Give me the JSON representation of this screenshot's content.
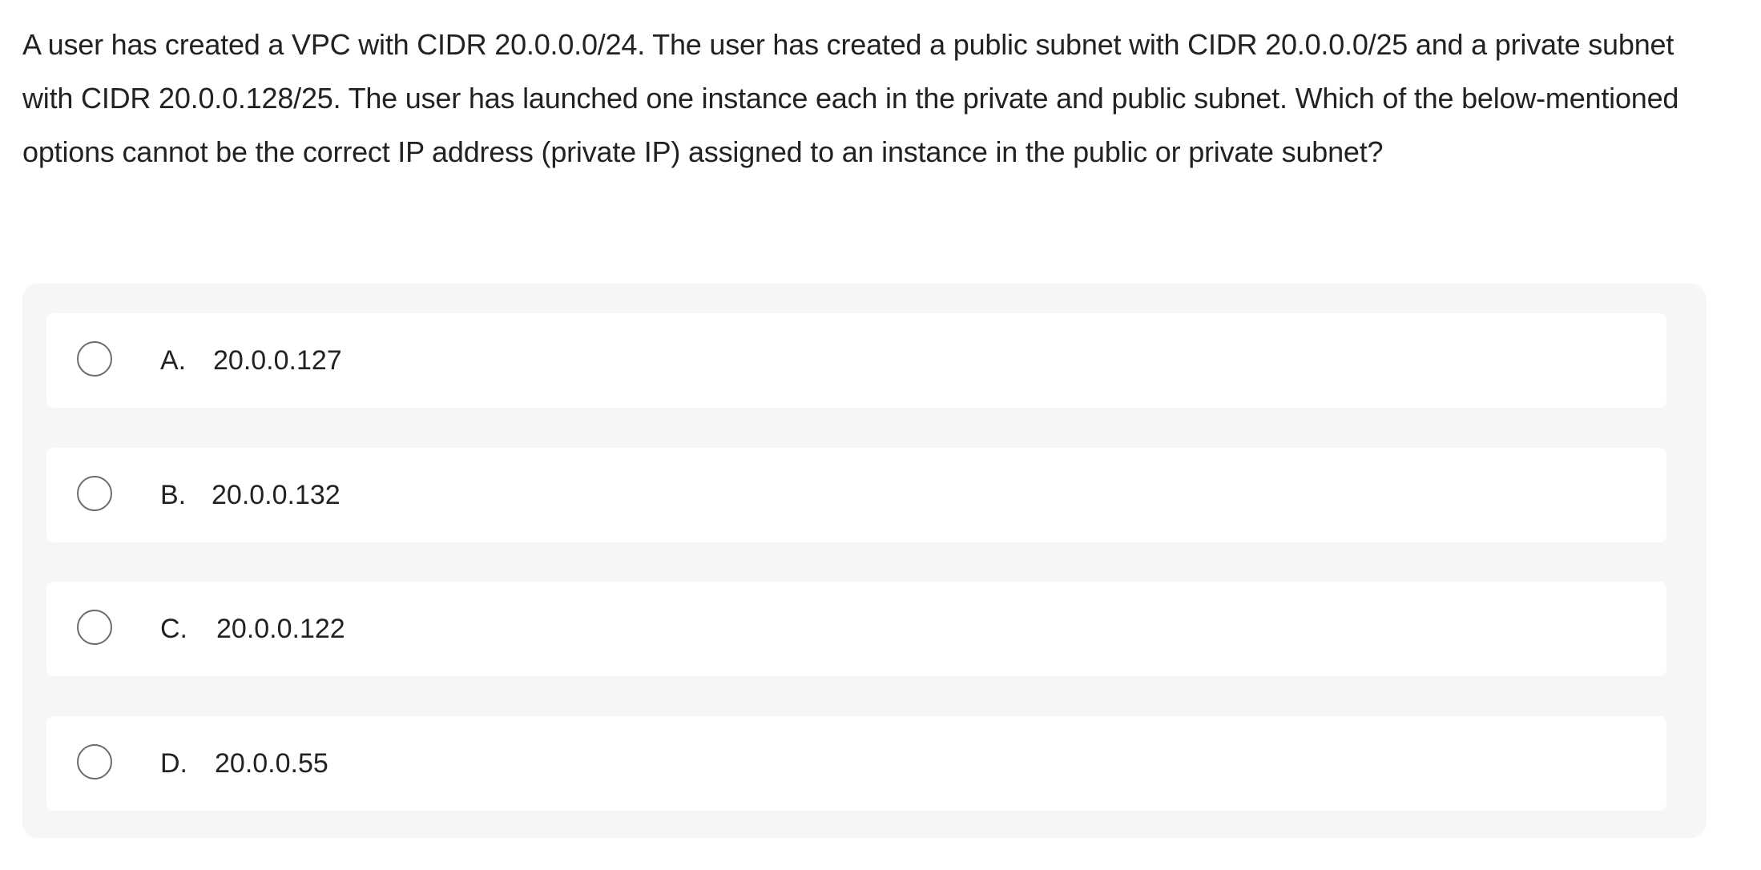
{
  "question": {
    "text": "A user has created a VPC with CIDR 20.0.0.0/24. The user has created a public subnet with CIDR 20.0.0.0/25 and a private subnet with CIDR 20.0.0.128/25. The user has launched one instance each in the private and public subnet. Which of the below-mentioned options cannot be the correct IP address (private IP) assigned to an instance in the public or private subnet?"
  },
  "options": [
    {
      "letter": "A.",
      "text": "20.0.0.127"
    },
    {
      "letter": "B.",
      "text": "20.0.0.132"
    },
    {
      "letter": "C.",
      "text": "20.0.0.122"
    },
    {
      "letter": "D.",
      "text": "20.0.0.55"
    }
  ],
  "colors": {
    "panel_background": "#f5f6f8",
    "option_background": "#ffffff",
    "radio_border": "#6b6b6b",
    "text": "#222222"
  }
}
